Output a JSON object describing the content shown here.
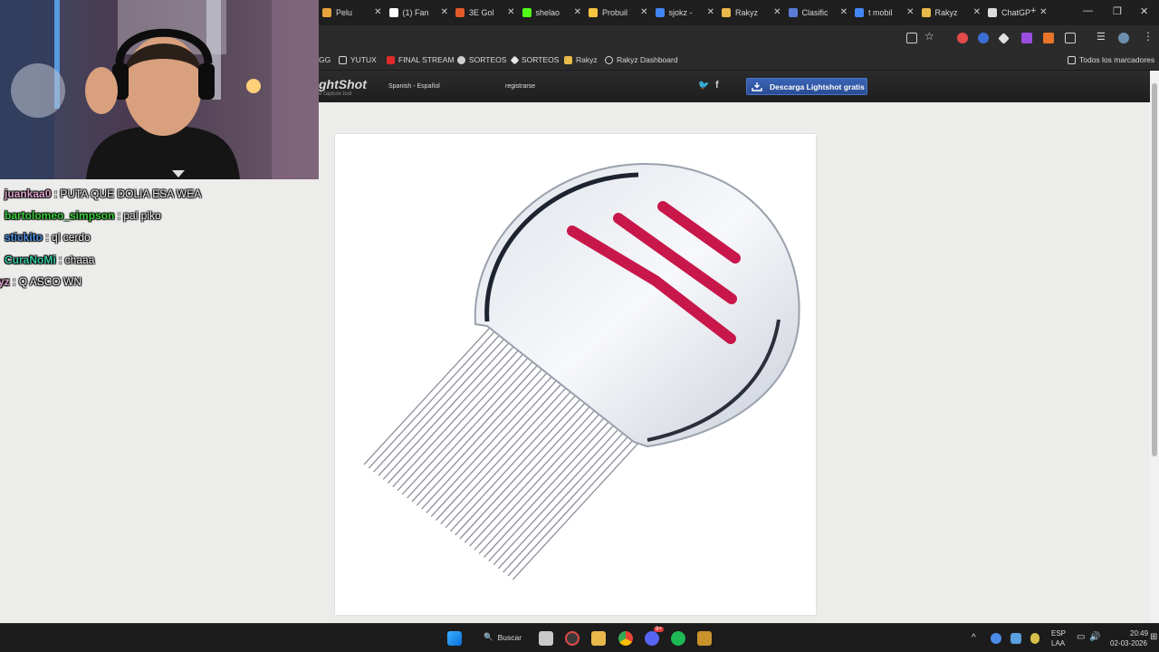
{
  "browser": {
    "tabs": [
      {
        "label": "Pelu",
        "color": "#e8a33c"
      },
      {
        "label": "(1) Fan",
        "color": "#ffffff"
      },
      {
        "label": "3E Gol",
        "color": "#e05a2a"
      },
      {
        "label": "shelao",
        "color": "#53fc18"
      },
      {
        "label": "Probuil",
        "color": "#f5c542"
      },
      {
        "label": "sjokz -",
        "color": "#4285f4"
      },
      {
        "label": "Rakyz",
        "color": "#e9b949"
      },
      {
        "label": "Clasific",
        "color": "#5b7bd5"
      },
      {
        "label": "t mobil",
        "color": "#4285f4"
      },
      {
        "label": "Rakyz",
        "color": "#e9b949"
      },
      {
        "label": "ChatGP",
        "color": "#dcdcdc"
      }
    ],
    "new_tab": "+",
    "bookmarks": [
      {
        "label": "GG"
      },
      {
        "label": "YUTUX",
        "icon": "folder-icon"
      },
      {
        "label": "FINAL STREAM",
        "icon": "youtube-icon"
      },
      {
        "label": "SORTEOS",
        "icon": "gear-icon"
      },
      {
        "label": "SORTEOS",
        "icon": "diamond-icon"
      },
      {
        "label": "Rakyz",
        "icon": "rakyz-icon"
      },
      {
        "label": "Rakyz Dashboard",
        "icon": "globe-icon"
      }
    ],
    "all_bookmarks": "Todos los marcadores"
  },
  "site": {
    "logo": "ghtShot",
    "tagline": "e capture tool",
    "language": "Spanish - Español",
    "register": "registrarse",
    "download_button": "Descarga Lightshot gratis"
  },
  "chat": [
    {
      "user": "juankaa0",
      "message": ": PUTA QUE DOLIA ESA WEA",
      "color": "#d8a0c8"
    },
    {
      "user": "bartolomeo_simpson",
      "message": ": pal piko",
      "color": "#38d138"
    },
    {
      "user": "stickito",
      "message": ": ql cerdo",
      "color": "#4f8fe0"
    },
    {
      "user": "CuraNoMi",
      "message": ": chaaa",
      "color": "#35c9a0"
    },
    {
      "user": "yz",
      "message": ": Q ASCO WN",
      "color": "#d8a0c8"
    }
  ],
  "taskbar": {
    "search_label": "Buscar",
    "discord_badge": "9+",
    "language": "ESP",
    "layout": "LAA",
    "time": "20:49",
    "date": "02-03-2026"
  }
}
